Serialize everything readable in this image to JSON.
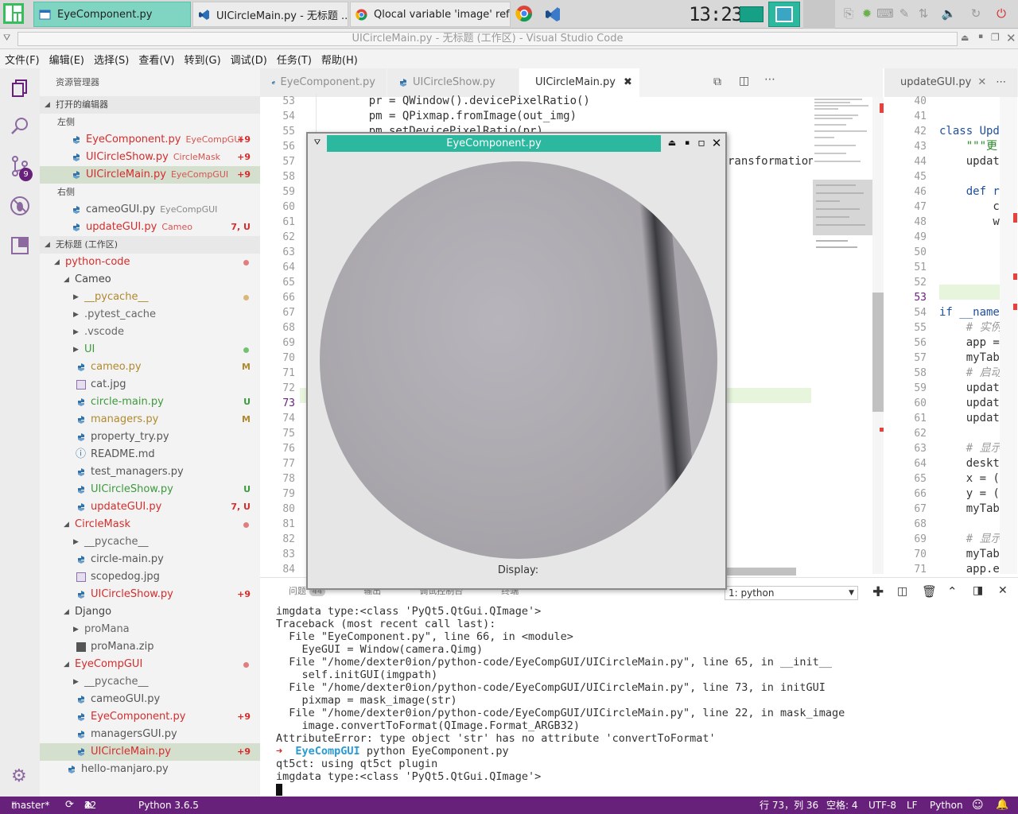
{
  "taskbar": {
    "tasks": [
      {
        "label": "EyeComponent.py",
        "active": true
      },
      {
        "label": "UICircleMain.py - 无标题 ..."
      },
      {
        "label": "Qlocal variable 'image' ref..."
      }
    ],
    "clock": "13:23"
  },
  "window": {
    "title": "UICircleMain.py - 无标题 (工作区) - Visual Studio Code"
  },
  "menu": [
    "文件(F)",
    "编辑(E)",
    "选择(S)",
    "查看(V)",
    "转到(G)",
    "调试(D)",
    "任务(T)",
    "帮助(H)"
  ],
  "activity": {
    "scm_badge": "9"
  },
  "explorer": {
    "title": "资源管理器",
    "open_editors": "打开的编辑器",
    "group_left": "左侧",
    "group_right": "右侧",
    "workspace": "无标题 (工作区)",
    "rows": [
      {
        "label": "EyeComponent.py",
        "sub": "EyeCompGUI",
        "badge": "+9",
        "color": "#d62c2c",
        "depth": 2
      },
      {
        "label": "UICircleShow.py",
        "sub": "CircleMask",
        "badge": "+9",
        "color": "#d62c2c",
        "depth": 2
      },
      {
        "label": "UICircleMain.py",
        "sub": "EyeCompGUI",
        "badge": "+9",
        "color": "#d62c2c",
        "depth": 2,
        "selected": true
      },
      {
        "label": "cameoGUI.py",
        "sub": "EyeCompGUI",
        "color": "#555",
        "depth": 2,
        "sub_color": "#888"
      },
      {
        "label": "updateGUI.py",
        "sub": "Cameo",
        "badge": "7, U",
        "color": "#d62c2c",
        "depth": 2
      },
      {
        "label": "python-code",
        "dot": "#e27d7d",
        "color": "#d62c2c",
        "depth": 1,
        "chev": "open"
      },
      {
        "label": "Cameo",
        "color": "#444",
        "depth": 2,
        "chev": "open"
      },
      {
        "label": "__pycache__",
        "dot": "#d9b77a",
        "color": "#b08a2e",
        "depth": 3,
        "chev": "closed"
      },
      {
        "label": ".pytest_cache",
        "color": "#666",
        "depth": 3,
        "chev": "closed"
      },
      {
        "label": ".vscode",
        "color": "#666",
        "depth": 3,
        "chev": "closed"
      },
      {
        "label": "UI",
        "dot": "#73c270",
        "color": "#3c9a3c",
        "depth": 3,
        "chev": "closed"
      },
      {
        "label": "cameo.py",
        "badge": "M",
        "color": "#b08a2e",
        "depth": 3,
        "badge_color": "#b08a2e"
      },
      {
        "label": "cat.jpg",
        "color": "#555",
        "depth": 3,
        "icon": "img"
      },
      {
        "label": "circle-main.py",
        "badge": "U",
        "color": "#3c9a3c",
        "depth": 3,
        "badge_color": "#3c9a3c"
      },
      {
        "label": "managers.py",
        "badge": "M",
        "color": "#b08a2e",
        "depth": 3,
        "badge_color": "#b08a2e"
      },
      {
        "label": "property_try.py",
        "color": "#555",
        "depth": 3
      },
      {
        "label": "README.md",
        "color": "#555",
        "depth": 3,
        "icon": "info"
      },
      {
        "label": "test_managers.py",
        "color": "#555",
        "depth": 3
      },
      {
        "label": "UICircleShow.py",
        "badge": "U",
        "color": "#3c9a3c",
        "depth": 3,
        "badge_color": "#3c9a3c"
      },
      {
        "label": "updateGUI.py",
        "badge": "7, U",
        "color": "#d62c2c",
        "depth": 3
      },
      {
        "label": "CircleMask",
        "dot": "#e27d7d",
        "color": "#d62c2c",
        "depth": 2,
        "chev": "open"
      },
      {
        "label": "__pycache__",
        "color": "#666",
        "depth": 3,
        "chev": "closed"
      },
      {
        "label": "circle-main.py",
        "color": "#555",
        "depth": 3
      },
      {
        "label": "scopedog.jpg",
        "color": "#555",
        "depth": 3,
        "icon": "img"
      },
      {
        "label": "UICircleShow.py",
        "badge": "+9",
        "color": "#d62c2c",
        "depth": 3
      },
      {
        "label": "Django",
        "color": "#444",
        "depth": 2,
        "chev": "open"
      },
      {
        "label": "proMana",
        "color": "#666",
        "depth": 3,
        "chev": "closed"
      },
      {
        "label": "proMana.zip",
        "color": "#555",
        "depth": 3,
        "icon": "zip"
      },
      {
        "label": "EyeCompGUI",
        "dot": "#e27d7d",
        "color": "#d62c2c",
        "depth": 2,
        "chev": "open"
      },
      {
        "label": "__pycache__",
        "color": "#666",
        "depth": 3,
        "chev": "closed"
      },
      {
        "label": "cameoGUI.py",
        "color": "#555",
        "depth": 3
      },
      {
        "label": "EyeComponent.py",
        "badge": "+9",
        "color": "#d62c2c",
        "depth": 3
      },
      {
        "label": "managersGUI.py",
        "color": "#555",
        "depth": 3
      },
      {
        "label": "UICircleMain.py",
        "badge": "+9",
        "color": "#d62c2c",
        "depth": 3,
        "selected": true
      },
      {
        "label": "hello-manjaro.py",
        "color": "#555",
        "depth": 2
      }
    ]
  },
  "editor": {
    "tabs": [
      "EyeComponent.py",
      "UICircleShow.py",
      "UICircleMain.py"
    ],
    "right_tab": "updateGUI.py",
    "left_lines": [
      "53",
      "54",
      "55",
      "56",
      "57",
      "58",
      "59",
      "60",
      "61",
      "62",
      "63",
      "64",
      "65",
      "66",
      "67",
      "68",
      "69",
      "70",
      "71",
      "72",
      "73",
      "74",
      "75",
      "76",
      "77",
      "78",
      "79",
      "80",
      "81",
      "82",
      "83",
      "84"
    ],
    "left_code": [
      "    pr = QWindow().devicePixelRatio()",
      "    pm = QPixmap.fromImage(out_img)",
      "    pm.setDevicePixelRatio(pr)"
    ],
    "left_code_fragment": "ransformation",
    "right_lines": [
      "40",
      "41",
      "42",
      "43",
      "44",
      "45",
      "46",
      "47",
      "48",
      "49",
      "50",
      "51",
      "52",
      "53",
      "54",
      "55",
      "56",
      "57",
      "58",
      "59",
      "60",
      "61",
      "62",
      "63",
      "64",
      "65",
      "66",
      "67",
      "68",
      "69",
      "70",
      "71"
    ],
    "right_code": [
      "",
      "",
      "class Upd",
      "    \"\"\"更",
      "    updat",
      "",
      "    def r",
      "        c",
      "        w",
      "",
      "",
      "",
      "",
      "",
      "if __name",
      "    # 实例",
      "    app =",
      "    myTab",
      "    # 启动",
      "    updat",
      "    updat",
      "    updat",
      "",
      "    # 显示",
      "    deskt",
      "    x = (",
      "    y = (",
      "    myTab",
      "",
      "    # 显示",
      "    myTab",
      "    app.e"
    ]
  },
  "dialog": {
    "title": "EyeComponent.py",
    "display_label": "Display:"
  },
  "panel": {
    "tabs": [
      "问题",
      "输出",
      "调试控制台",
      "终端"
    ],
    "problems_count": "44",
    "terminal_select": "1: python",
    "terminal": [
      "imgdata type:<class 'PyQt5.QtGui.QImage'>",
      "Traceback (most recent call last):",
      "  File \"EyeComponent.py\", line 66, in <module>",
      "    EyeGUI = Window(camera.Qimg)",
      "  File \"/home/dexter0ion/python-code/EyeCompGUI/UICircleMain.py\", line 65, in __init__",
      "    self.initGUI(imgpath)",
      "  File \"/home/dexter0ion/python-code/EyeCompGUI/UICircleMain.py\", line 73, in initGUI",
      "    pixmap = mask_image(str)",
      "  File \"/home/dexter0ion/python-code/EyeCompGUI/UICircleMain.py\", line 22, in mask_image",
      "    image.convertToFormat(QImage.Format_ARGB32)",
      "AttributeError: type object 'str' has no attribute 'convertToFormat'"
    ],
    "prompt_arrow": "➜",
    "prompt_dir": "EyeCompGUI",
    "prompt_cmd": "python EyeComponent.py",
    "after": [
      "qt5ct: using qt5ct plugin",
      "imgdata type:<class 'PyQt5.QtGui.QImage'>"
    ]
  },
  "status": {
    "branch": "master*",
    "errors": "42",
    "warnings": "2",
    "python": "Python 3.6.5",
    "position": "行 73，列 36",
    "spaces": "空格: 4",
    "encoding": "UTF-8",
    "eol": "LF",
    "language": "Python"
  },
  "colors": {
    "accent": "#2bb89f",
    "status_bg": "#68217a",
    "error": "#d62c2c"
  }
}
